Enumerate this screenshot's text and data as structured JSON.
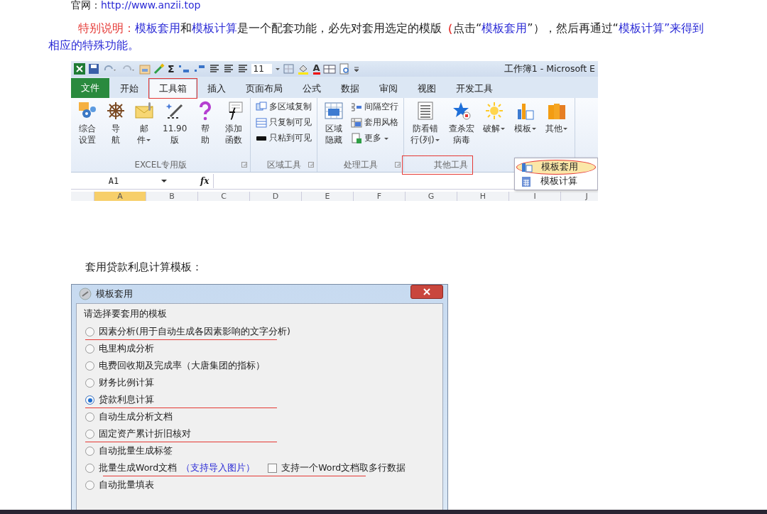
{
  "site_line": {
    "label": "官网：",
    "link": "http://www.anzii.top"
  },
  "note": [
    {
      "text": "特别说明：",
      "color": "#e53935"
    },
    {
      "text": "模板套用",
      "color": "#2b2bd6"
    },
    {
      "text": "和",
      "color": "#222222"
    },
    {
      "text": "模板计算",
      "color": "#2b2bd6"
    },
    {
      "text": "是一个配套功能，必先对套用选定的模版",
      "color": "#222222"
    },
    {
      "text": "（",
      "color": "#e53935"
    },
    {
      "text": "点击“",
      "color": "#222222"
    },
    {
      "text": "模板套用",
      "color": "#2b2bd6"
    },
    {
      "text": "”），然后再通过“",
      "color": "#222222"
    },
    {
      "text": "模板计算",
      "color": "#2b2bd6"
    },
    {
      "text": "”来得到相应的特殊功能。",
      "color": "#2b2bd6"
    }
  ],
  "excel": {
    "quick_access": {
      "sum_glyph": "Σ",
      "font_size": "11",
      "font_color_glyph": "A",
      "title": "工作簿1 - Microsoft E"
    },
    "tabs": [
      {
        "label": "文件",
        "kind": "file",
        "selected": false
      },
      {
        "label": "开始",
        "kind": "tab",
        "selected": false
      },
      {
        "label": "工具箱",
        "kind": "tab",
        "selected": true,
        "annotated": true
      },
      {
        "label": "插入",
        "kind": "tab",
        "selected": false
      },
      {
        "label": "页面布局",
        "kind": "tab",
        "selected": false
      },
      {
        "label": "公式",
        "kind": "tab",
        "selected": false
      },
      {
        "label": "数据",
        "kind": "tab",
        "selected": false
      },
      {
        "label": "审阅",
        "kind": "tab",
        "selected": false
      },
      {
        "label": "视图",
        "kind": "tab",
        "selected": false
      },
      {
        "label": "开发工具",
        "kind": "tab",
        "selected": false
      }
    ],
    "groups": [
      {
        "label": "EXCEL专用版",
        "launcher": true,
        "big": [
          {
            "lines": [
              "综合",
              "设置"
            ]
          },
          {
            "lines": [
              "导",
              "航"
            ]
          },
          {
            "lines": [
              "邮",
              "件"
            ],
            "dropdown": true
          },
          {
            "lines": [
              "11.90",
              "版"
            ]
          },
          {
            "lines": [
              "帮",
              "助"
            ]
          },
          {
            "lines": [
              "添加",
              "函数"
            ]
          }
        ]
      },
      {
        "label": "区域工具",
        "launcher": true,
        "small": [
          {
            "label": "多区域复制"
          },
          {
            "label": "只复制可见"
          },
          {
            "label": "只粘到可见"
          }
        ]
      },
      {
        "label": "处理工具",
        "launcher": true,
        "big": [
          {
            "lines": [
              "区域",
              "隐藏"
            ]
          }
        ],
        "small": [
          {
            "label": "间隔空行"
          },
          {
            "label": "套用风格"
          },
          {
            "label": "更多",
            "dropdown": true
          }
        ]
      },
      {
        "label": "其他工具",
        "annotated": true,
        "big": [
          {
            "lines": [
              "防看错",
              "行(列)"
            ],
            "dropdown": true
          },
          {
            "lines": [
              "查杀宏",
              "病毒"
            ]
          },
          {
            "lines": [
              "破解"
            ],
            "dropdown": true
          },
          {
            "lines": [
              "模板"
            ],
            "dropdown": true
          },
          {
            "lines": [
              "其他"
            ],
            "dropdown": true
          }
        ]
      }
    ],
    "name_box": "A1",
    "formula_label": "fx",
    "columns": [
      "A",
      "B",
      "C",
      "D",
      "E",
      "F",
      "G",
      "H",
      "I",
      "J"
    ],
    "menu": [
      {
        "label": "模板套用",
        "selected": true,
        "annotated": true
      },
      {
        "label": "模板计算",
        "selected": false
      }
    ]
  },
  "caption": "套用贷款利息计算模板：",
  "dialog": {
    "title": "模板套用",
    "group_label": "请选择要套用的模板",
    "options": [
      {
        "label": "因素分析(用于自动生成各因素影响的文字分析)",
        "selected": false,
        "underlined": true
      },
      {
        "label": "电里构成分析",
        "selected": false
      },
      {
        "label": "电费回收期及完成率（大唐集团的指标）",
        "selected": false
      },
      {
        "label": "财务比例计算",
        "selected": false
      },
      {
        "label": "贷款利息计算",
        "selected": true,
        "underlined": true
      },
      {
        "label": "自动生成分析文档",
        "selected": false
      },
      {
        "label": "固定资产累计折旧核对",
        "selected": false,
        "underlined": true
      },
      {
        "label": "自动批量生成标签",
        "selected": false
      },
      {
        "label": "批量生成Word文档",
        "selected": false,
        "underlined": true,
        "note": "（支持导入图片）",
        "checkbox": {
          "label": "支持一个Word文档取多行数据",
          "checked": false
        }
      },
      {
        "label": "自动批量填表",
        "selected": false
      }
    ]
  }
}
